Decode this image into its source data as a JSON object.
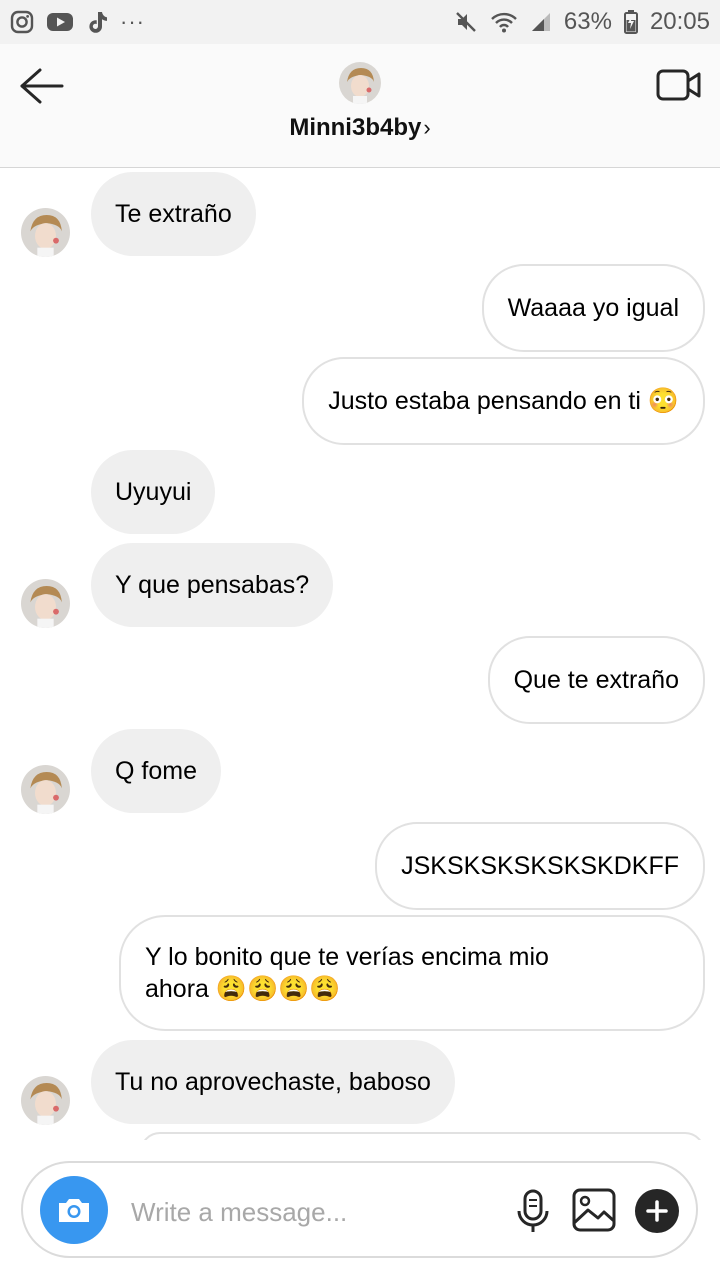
{
  "status_bar": {
    "left_icons": [
      "instagram-icon",
      "youtube-icon",
      "tiktok-icon",
      "more-icon"
    ],
    "more": "···",
    "battery": "63%",
    "time": "20:05"
  },
  "header": {
    "username": "Minni3b4by",
    "chevron": "›"
  },
  "messages": [
    {
      "side": "in",
      "text": "Te extraño"
    },
    {
      "side": "out",
      "text": "Waaaa yo igual"
    },
    {
      "side": "out",
      "text": "Justo estaba pensando en ti 😳"
    },
    {
      "side": "in",
      "text": "Uyuyui"
    },
    {
      "side": "in",
      "text": "Y que pensabas?"
    },
    {
      "side": "out",
      "text": "Que te extraño"
    },
    {
      "side": "in",
      "text": "Q fome"
    },
    {
      "side": "out",
      "text": "JSKSKSKSKSKSKDKFF"
    },
    {
      "side": "out",
      "text_line1": "Y lo bonito que te verías encima mio",
      "text_line2": "ahora 😩😩😩😩"
    },
    {
      "side": "in",
      "text": "Tu no aprovechaste, baboso"
    }
  ],
  "composer": {
    "placeholder": "Write a message..."
  },
  "colors": {
    "accent": "#3897f0",
    "incoming_bubble": "#efefef",
    "outgoing_border": "#e1e1e1"
  }
}
